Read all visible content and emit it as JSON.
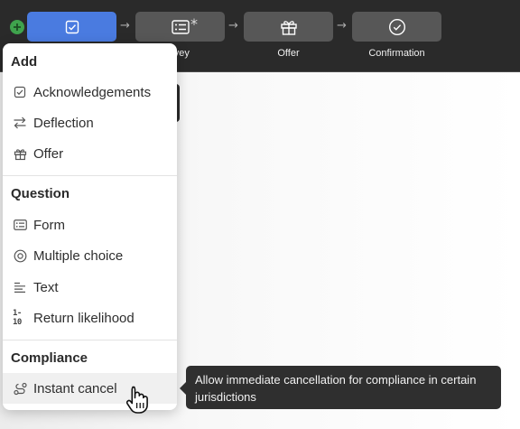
{
  "colors": {
    "topbar_bg": "#2a2a2a",
    "step_active": "#4a7be0",
    "step_inactive": "#575757",
    "add_button": "#3fa34d",
    "tooltip_bg": "#2f2f2f"
  },
  "steps": [
    {
      "icon": "checkbox-icon",
      "label": "",
      "active": true
    },
    {
      "icon": "form-list-icon",
      "label": "rvey",
      "modified_marker": "*",
      "active": false
    },
    {
      "icon": "gift-icon",
      "label": "Offer",
      "active": false
    },
    {
      "icon": "check-circle-icon",
      "label": "Confirmation",
      "active": false
    }
  ],
  "step_arrow": "→",
  "menu": {
    "sections": [
      {
        "heading": "Add",
        "items": [
          {
            "label": "Acknowledgements",
            "icon": "checkbox-icon"
          },
          {
            "label": "Deflection",
            "icon": "swap-arrows-icon"
          },
          {
            "label": "Offer",
            "icon": "gift-icon"
          }
        ]
      },
      {
        "heading": "Question",
        "items": [
          {
            "label": "Form",
            "icon": "form-list-icon"
          },
          {
            "label": "Multiple choice",
            "icon": "radio-target-icon"
          },
          {
            "label": "Text",
            "icon": "text-lines-icon"
          },
          {
            "label": "Return likelihood",
            "icon": "scale-1-10-icon",
            "icon_text": "1-10"
          }
        ]
      },
      {
        "heading": "Compliance",
        "items": [
          {
            "label": "Instant cancel",
            "icon": "route-icon",
            "hovered": true
          }
        ]
      }
    ]
  },
  "tooltip": {
    "text": "Allow immediate cancellation for compliance in certain jurisdictions"
  }
}
